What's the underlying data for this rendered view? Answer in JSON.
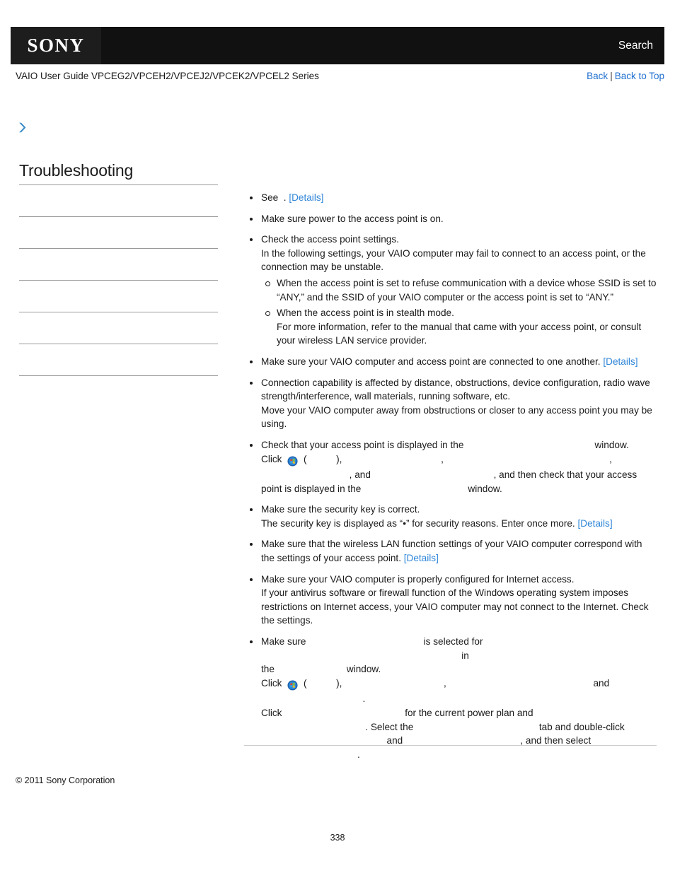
{
  "header": {
    "logo_text": "SONY",
    "search_label": "Search",
    "guide_title": "VAIO User Guide VPCEG2/VPCEH2/VPCEJ2/VPCEK2/VPCEL2 Series",
    "nav": {
      "back_label": "Back",
      "separator": "|",
      "back_to_top_label": "Back to Top"
    }
  },
  "breadcrumb": {
    "icon": "chevron-right-icon",
    "text": ""
  },
  "sidebar": {
    "title": "Troubleshooting",
    "items": [
      {
        "label": ""
      },
      {
        "label": ""
      },
      {
        "label": ""
      },
      {
        "label": ""
      },
      {
        "label": ""
      },
      {
        "label": ""
      }
    ]
  },
  "content": {
    "bullets": [
      {
        "id": "see-details",
        "lines": [
          {
            "segments": [
              {
                "t": "text",
                "v": "See "
              },
              {
                "t": "blank",
                "v": " "
              },
              {
                "t": "text",
                "v": ". "
              },
              {
                "t": "link",
                "v": "[Details]"
              }
            ]
          }
        ]
      },
      {
        "id": "power-on",
        "lines": [
          {
            "segments": [
              {
                "t": "text",
                "v": "Make sure power to the access point is on."
              }
            ]
          }
        ]
      },
      {
        "id": "check-ap-settings",
        "lines": [
          {
            "segments": [
              {
                "t": "text",
                "v": "Check the access point settings."
              }
            ]
          },
          {
            "segments": [
              {
                "t": "text",
                "v": "In the following settings, your VAIO computer may fail to connect to an access point, or the connection may be unstable."
              }
            ]
          }
        ],
        "subbullets": [
          {
            "lines": [
              {
                "segments": [
                  {
                    "t": "text",
                    "v": "When the access point is set to refuse communication with a device whose SSID is set to “ANY,” and the SSID of your VAIO computer or the access point is set to “ANY.”"
                  }
                ]
              }
            ]
          },
          {
            "lines": [
              {
                "segments": [
                  {
                    "t": "text",
                    "v": "When the access point is in stealth mode."
                  }
                ]
              },
              {
                "segments": [
                  {
                    "t": "text",
                    "v": "For more information, refer to the manual that came with your access point, or consult your wireless LAN service provider."
                  }
                ]
              }
            ]
          }
        ]
      },
      {
        "id": "connected-to-one-another",
        "lines": [
          {
            "segments": [
              {
                "t": "text",
                "v": "Make sure your VAIO computer and access point are connected to one another. "
              },
              {
                "t": "link",
                "v": "[Details]"
              }
            ]
          }
        ]
      },
      {
        "id": "connection-capability",
        "lines": [
          {
            "segments": [
              {
                "t": "text",
                "v": "Connection capability is affected by distance, obstructions, device configuration, radio wave strength/interference, wall materials, running software, etc."
              }
            ]
          },
          {
            "segments": [
              {
                "t": "text",
                "v": "Move your VAIO computer away from obstructions or closer to any access point you may be using."
              }
            ]
          }
        ]
      },
      {
        "id": "ap-displayed-in-window",
        "lines": [
          {
            "segments": [
              {
                "t": "text",
                "v": "Check that your access point is displayed in the "
              },
              {
                "t": "blank",
                "v": "                                               "
              },
              {
                "t": "text",
                "v": " window."
              }
            ]
          },
          {
            "segments": [
              {
                "t": "text",
                "v": "Click "
              },
              {
                "t": "icon",
                "v": "windows-start-orb-icon"
              },
              {
                "t": "text",
                "v": " ("
              },
              {
                "t": "blank",
                "v": "           "
              },
              {
                "t": "text",
                "v": "), "
              },
              {
                "t": "blank",
                "v": "                                    "
              },
              {
                "t": "text",
                "v": ", "
              },
              {
                "t": "blank",
                "v": "                                                             "
              },
              {
                "t": "text",
                "v": ","
              }
            ]
          },
          {
            "segments": [
              {
                "t": "blank",
                "v": "                                 "
              },
              {
                "t": "text",
                "v": ", and "
              },
              {
                "t": "blank",
                "v": "                                             "
              },
              {
                "t": "text",
                "v": ", and then check that your access"
              }
            ]
          },
          {
            "segments": [
              {
                "t": "text",
                "v": "point is displayed in the "
              },
              {
                "t": "blank",
                "v": "                                      "
              },
              {
                "t": "text",
                "v": " window."
              }
            ]
          }
        ]
      },
      {
        "id": "security-key",
        "lines": [
          {
            "segments": [
              {
                "t": "text",
                "v": "Make sure the security key is correct."
              }
            ]
          },
          {
            "segments": [
              {
                "t": "text",
                "v": "The security key is displayed as “•” for security reasons. Enter once more. "
              },
              {
                "t": "link",
                "v": "[Details]"
              }
            ]
          }
        ]
      },
      {
        "id": "wireless-lan-settings-correspond",
        "lines": [
          {
            "segments": [
              {
                "t": "text",
                "v": "Make sure that the wireless LAN function settings of your VAIO computer correspond with the settings of your access point. "
              },
              {
                "t": "link",
                "v": "[Details]"
              }
            ]
          }
        ]
      },
      {
        "id": "internet-access-config",
        "lines": [
          {
            "segments": [
              {
                "t": "text",
                "v": "Make sure your VAIO computer is properly configured for Internet access."
              }
            ]
          },
          {
            "segments": [
              {
                "t": "text",
                "v": "If your antivirus software or firewall function of the Windows operating system imposes restrictions on Internet access, your VAIO computer may not connect to the Internet. Check the settings."
              }
            ]
          }
        ]
      },
      {
        "id": "power-plan-wireless-adapter",
        "lines": [
          {
            "segments": [
              {
                "t": "text",
                "v": "Make sure "
              },
              {
                "t": "blank",
                "v": "                                          "
              },
              {
                "t": "text",
                "v": " is selected for "
              },
              {
                "t": "blank",
                "v": "                                                                          "
              },
              {
                "t": "text",
                "v": " in"
              }
            ]
          },
          {
            "segments": [
              {
                "t": "text",
                "v": "the "
              },
              {
                "t": "blank",
                "v": "                         "
              },
              {
                "t": "text",
                "v": " window."
              }
            ]
          },
          {
            "segments": [
              {
                "t": "text",
                "v": "Click "
              },
              {
                "t": "icon",
                "v": "windows-start-orb-icon"
              },
              {
                "t": "text",
                "v": " ("
              },
              {
                "t": "blank",
                "v": "           "
              },
              {
                "t": "text",
                "v": "), "
              },
              {
                "t": "blank",
                "v": "                                     "
              },
              {
                "t": "text",
                "v": ", "
              },
              {
                "t": "blank",
                "v": "                                                     "
              },
              {
                "t": "text",
                "v": " and "
              },
              {
                "t": "blank",
                "v": "                                      "
              },
              {
                "t": "text",
                "v": "."
              }
            ]
          },
          {
            "segments": [
              {
                "t": "text",
                "v": "Click "
              },
              {
                "t": "blank",
                "v": "                                            "
              },
              {
                "t": "text",
                "v": " for the current power plan and"
              }
            ]
          },
          {
            "segments": [
              {
                "t": "blank",
                "v": "                                       "
              },
              {
                "t": "text",
                "v": ". Select the "
              },
              {
                "t": "blank",
                "v": "                                             "
              },
              {
                "t": "text",
                "v": " tab and double-click"
              }
            ]
          },
          {
            "segments": [
              {
                "t": "blank",
                "v": "                                              "
              },
              {
                "t": "text",
                "v": " and "
              },
              {
                "t": "blank",
                "v": "                                           "
              },
              {
                "t": "text",
                "v": ", and then select "
              },
              {
                "t": "blank",
                "v": " "
              }
            ]
          },
          {
            "segments": [
              {
                "t": "blank",
                "v": "                                    "
              },
              {
                "t": "text",
                "v": "."
              }
            ]
          }
        ]
      }
    ]
  },
  "footer": {
    "copyright": "© 2011 Sony Corporation",
    "page_number": "338"
  },
  "colors": {
    "link": "#2f86d8",
    "nav_link": "#1f6fd0",
    "header_bg": "#111111",
    "logo_bg": "#1d1d1d",
    "rule": "#9a9a9a",
    "accent_chevron": "#3a8cc8"
  }
}
